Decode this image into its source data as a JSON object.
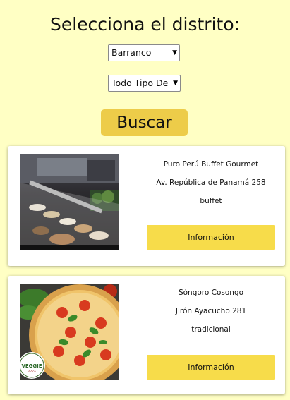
{
  "page": {
    "title": "Selecciona el distrito:"
  },
  "filters": {
    "district": {
      "selected": "Barranco"
    },
    "food_type": {
      "selected": "Todo Tipo De Comida"
    }
  },
  "search_button": {
    "label": "Buscar"
  },
  "restaurants": [
    {
      "name": "Puro Perú Buffet Gourmet",
      "address": "Av. República de Panamá 258",
      "category": "buffet",
      "button_label": "Información",
      "image": "buffet-photo"
    },
    {
      "name": "Sóngoro Cosongo",
      "address": "Jirón Ayacucho 281",
      "category": "tradicional",
      "button_label": "Información",
      "image": "pizza-photo",
      "logo_text": [
        "VEGGIE",
        "PIZZA"
      ]
    }
  ]
}
